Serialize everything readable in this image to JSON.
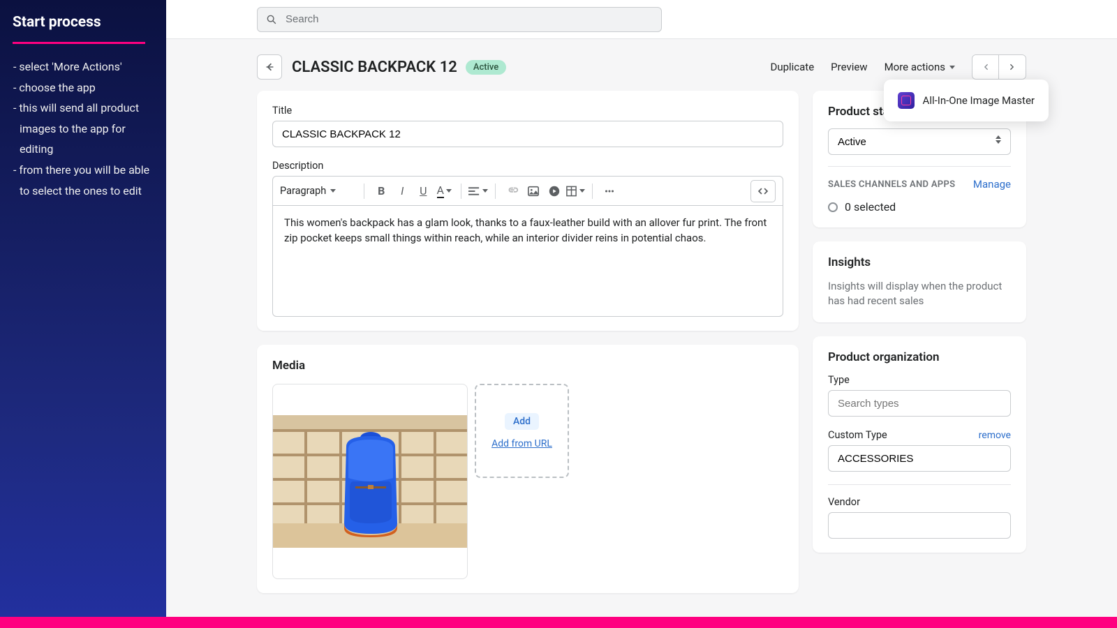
{
  "sidebar": {
    "title": "Start process",
    "steps": [
      "- select 'More Actions'",
      "- choose the app",
      "- this will send all product images to the app for editing",
      "- from there you will be able to select the ones to edit"
    ]
  },
  "search": {
    "placeholder": "Search"
  },
  "page": {
    "title": "CLASSIC BACKPACK 12",
    "status_badge": "Active"
  },
  "actions": {
    "duplicate": "Duplicate",
    "preview": "Preview",
    "more": "More actions"
  },
  "dropdown": {
    "item": "All-In-One Image Master"
  },
  "form": {
    "title_label": "Title",
    "title_value": "CLASSIC BACKPACK 12",
    "desc_label": "Description",
    "paragraph": "Paragraph",
    "description_text": "This women's backpack has a glam look, thanks to a faux-leather build with an allover fur print. The front zip pocket keeps small things within reach, while an interior divider reins in potential chaos."
  },
  "media": {
    "title": "Media",
    "add": "Add",
    "add_url": "Add from URL"
  },
  "status": {
    "title": "Product status",
    "value": "Active"
  },
  "channels": {
    "label": "SALES CHANNELS AND APPS",
    "manage": "Manage",
    "selected": "0 selected"
  },
  "insights": {
    "title": "Insights",
    "body": "Insights will display when the product has had recent sales"
  },
  "org": {
    "title": "Product organization",
    "type_label": "Type",
    "type_placeholder": "Search types",
    "custom_label": "Custom Type",
    "remove": "remove",
    "custom_value": "ACCESSORIES",
    "vendor_label": "Vendor"
  }
}
